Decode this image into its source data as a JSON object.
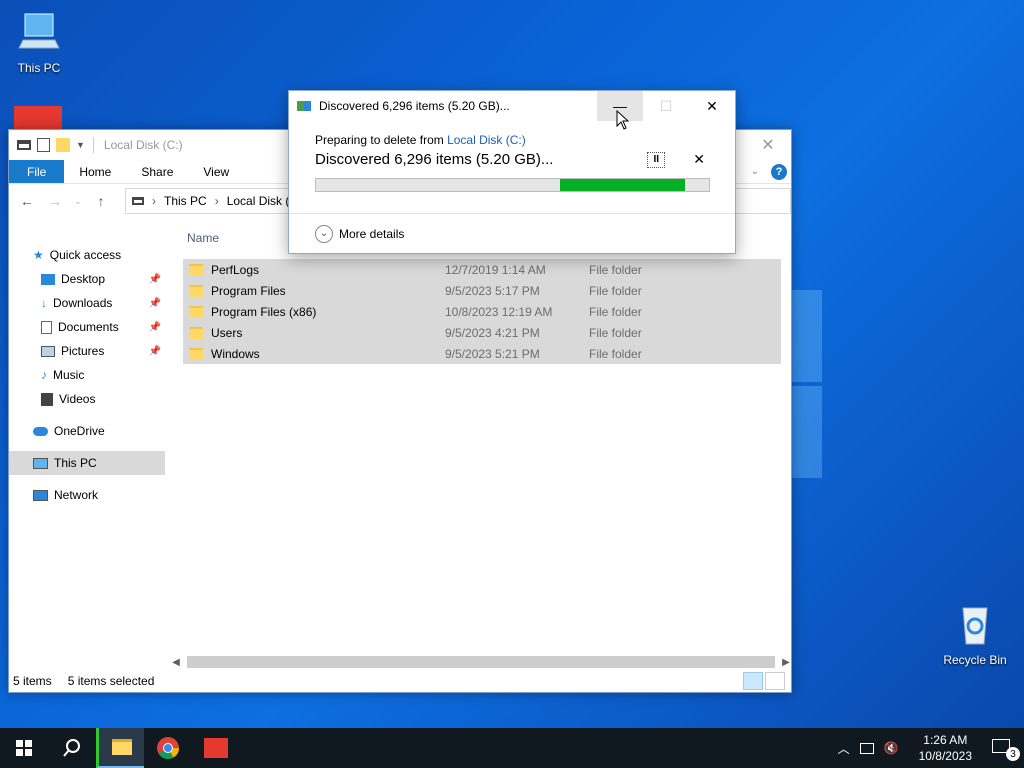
{
  "desktop": {
    "icons": [
      {
        "label": "This PC",
        "icon": "computer-icon"
      },
      {
        "label": "Recycle Bin",
        "icon": "recycle-bin-icon"
      }
    ]
  },
  "explorer": {
    "title": "Local Disk (C:)",
    "ribbon_tabs": [
      "File",
      "Home",
      "Share",
      "View"
    ],
    "breadcrumb": [
      "This PC",
      "Local Disk (C:"
    ],
    "column_header": "Name",
    "sidebar": {
      "quick_access": "Quick access",
      "items": [
        "Desktop",
        "Downloads",
        "Documents",
        "Pictures",
        "Music",
        "Videos"
      ],
      "onedrive": "OneDrive",
      "this_pc": "This PC",
      "network": "Network"
    },
    "rows": [
      {
        "name": "PerfLogs",
        "date": "12/7/2019 1:14 AM",
        "type": "File folder"
      },
      {
        "name": "Program Files",
        "date": "9/5/2023 5:17 PM",
        "type": "File folder"
      },
      {
        "name": "Program Files (x86)",
        "date": "10/8/2023 12:19 AM",
        "type": "File folder"
      },
      {
        "name": "Users",
        "date": "9/5/2023 4:21 PM",
        "type": "File folder"
      },
      {
        "name": "Windows",
        "date": "9/5/2023 5:21 PM",
        "type": "File folder"
      }
    ],
    "status": {
      "count": "5 items",
      "selected": "5 items selected"
    }
  },
  "dialog": {
    "title": "Discovered 6,296 items (5.20 GB)...",
    "prefix": "Preparing to delete from ",
    "location_link": "Local Disk (C:)",
    "headline": "Discovered 6,296 items (5.20 GB)...",
    "progress": {
      "fill_start": 0.62,
      "fill_end": 0.94
    },
    "more_details": "More details"
  },
  "taskbar": {
    "time": "1:26 AM",
    "date": "10/8/2023",
    "notification_count": "3"
  },
  "colors": {
    "accent": "#1979ca",
    "progress_green": "#06b025",
    "selection": "#d9d9d9"
  }
}
